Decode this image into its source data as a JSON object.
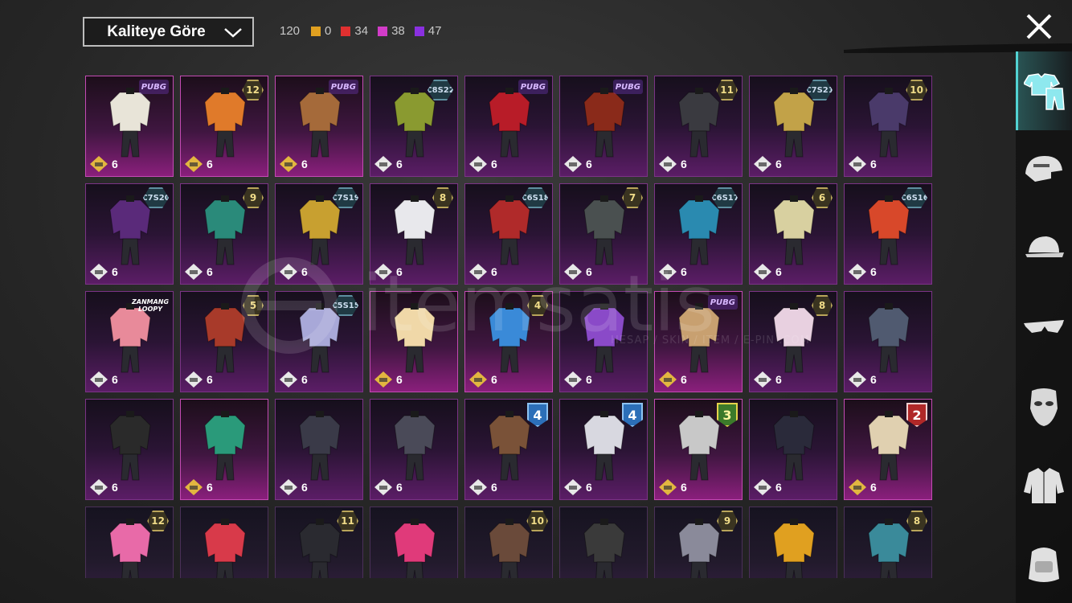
{
  "header": {
    "sort_label": "Kaliteye Göre",
    "total_count": "120",
    "quality_counts": [
      {
        "value": "0",
        "color": "#e0a020"
      },
      {
        "value": "34",
        "color": "#e03030"
      },
      {
        "value": "38",
        "color": "#d23cc8"
      },
      {
        "value": "47",
        "color": "#8a30e0"
      }
    ]
  },
  "sidebar": {
    "tabs": [
      {
        "name": "outfit-tab",
        "icon": "shirt-pants-icon",
        "active": true
      },
      {
        "name": "helmet-tab",
        "icon": "helmet-icon"
      },
      {
        "name": "cap-tab",
        "icon": "cap-icon"
      },
      {
        "name": "glasses-tab",
        "icon": "glasses-icon"
      },
      {
        "name": "mask-tab",
        "icon": "mask-icon"
      },
      {
        "name": "jacket-tab",
        "icon": "jacket-icon"
      },
      {
        "name": "bag-tab",
        "icon": "backpack-icon"
      }
    ]
  },
  "watermark": {
    "text": "itemsatis",
    "subtext": "HESAP / SKIN / ITEM / E-PIN .COM"
  },
  "items": [
    {
      "quality": "pink",
      "badge": "PUBG",
      "badge_type": "logo",
      "status": "gold",
      "count": "6"
    },
    {
      "quality": "pink",
      "badge": "12",
      "badge_type": "level",
      "status": "gold",
      "count": "6"
    },
    {
      "quality": "pink",
      "badge": "PUBG",
      "badge_type": "logo",
      "status": "gold",
      "count": "6"
    },
    {
      "quality": "purple",
      "badge": "C8S22",
      "badge_type": "season",
      "status": "white",
      "count": "6"
    },
    {
      "quality": "purple",
      "badge": "PUBG",
      "badge_type": "logo",
      "status": "white",
      "count": "6"
    },
    {
      "quality": "purple",
      "badge": "PUBG",
      "badge_type": "logo",
      "status": "white",
      "count": "6"
    },
    {
      "quality": "purple",
      "badge": "11",
      "badge_type": "level",
      "status": "white",
      "count": "6"
    },
    {
      "quality": "purple",
      "badge": "C7S21",
      "badge_type": "season",
      "status": "white",
      "count": "6"
    },
    {
      "quality": "purple",
      "badge": "10",
      "badge_type": "level",
      "status": "white",
      "count": "6"
    },
    {
      "quality": "purple",
      "badge": "C7S20",
      "badge_type": "season",
      "status": "white",
      "count": "6"
    },
    {
      "quality": "purple",
      "badge": "9",
      "badge_type": "level",
      "status": "white",
      "count": "6"
    },
    {
      "quality": "purple",
      "badge": "C7S19",
      "badge_type": "season",
      "status": "white",
      "count": "6"
    },
    {
      "quality": "purple",
      "badge": "8",
      "badge_type": "level",
      "status": "white",
      "count": "6"
    },
    {
      "quality": "purple",
      "badge": "C6S18",
      "badge_type": "season",
      "status": "white",
      "count": "6"
    },
    {
      "quality": "purple",
      "badge": "7",
      "badge_type": "level",
      "status": "white",
      "count": "6"
    },
    {
      "quality": "purple",
      "badge": "C6S17",
      "badge_type": "season",
      "status": "white",
      "count": "6"
    },
    {
      "quality": "purple",
      "badge": "6",
      "badge_type": "level",
      "status": "white",
      "count": "6"
    },
    {
      "quality": "purple",
      "badge": "C6S16",
      "badge_type": "season",
      "status": "white",
      "count": "6"
    },
    {
      "quality": "purple",
      "badge": "ZANMANG LOOPY",
      "badge_type": "text-logo",
      "status": "white",
      "count": "6"
    },
    {
      "quality": "purple",
      "badge": "5",
      "badge_type": "level",
      "status": "white",
      "count": "6"
    },
    {
      "quality": "purple",
      "badge": "C5S15",
      "badge_type": "season",
      "status": "white",
      "count": "6"
    },
    {
      "quality": "pink",
      "badge": "",
      "badge_type": "none",
      "status": "gold",
      "count": "6"
    },
    {
      "quality": "pink",
      "badge": "4",
      "badge_type": "level",
      "status": "gold",
      "count": "6"
    },
    {
      "quality": "purple",
      "badge": "",
      "badge_type": "none",
      "status": "white",
      "count": "6"
    },
    {
      "quality": "pink",
      "badge": "PUBG",
      "badge_type": "logo",
      "status": "gold",
      "count": "6"
    },
    {
      "quality": "purple",
      "badge": "8",
      "badge_type": "level",
      "status": "white",
      "count": "6"
    },
    {
      "quality": "purple",
      "badge": "",
      "badge_type": "none",
      "status": "white",
      "count": "6"
    },
    {
      "quality": "purple",
      "badge": "",
      "badge_type": "none",
      "status": "white",
      "count": "6"
    },
    {
      "quality": "pink",
      "badge": "",
      "badge_type": "none",
      "status": "gold",
      "count": "6"
    },
    {
      "quality": "purple",
      "badge": "",
      "badge_type": "none",
      "status": "white",
      "count": "6"
    },
    {
      "quality": "purple",
      "badge": "",
      "badge_type": "none",
      "status": "white",
      "count": "6"
    },
    {
      "quality": "purple",
      "badge": "4",
      "badge_type": "shield-blue",
      "status": "white",
      "count": "6"
    },
    {
      "quality": "purple",
      "badge": "4",
      "badge_type": "shield-blue",
      "status": "white",
      "count": "6"
    },
    {
      "quality": "pink",
      "badge": "3",
      "badge_type": "shield-green",
      "status": "gold",
      "count": "6"
    },
    {
      "quality": "purple",
      "badge": "",
      "badge_type": "none",
      "status": "white",
      "count": "6"
    },
    {
      "quality": "pink",
      "badge": "2",
      "badge_type": "shield-red",
      "status": "gold",
      "count": "6"
    },
    {
      "quality": "dark",
      "badge": "12",
      "badge_type": "level",
      "status": "none",
      "count": ""
    },
    {
      "quality": "dark",
      "badge": "",
      "badge_type": "none",
      "status": "none",
      "count": ""
    },
    {
      "quality": "dark",
      "badge": "11",
      "badge_type": "level",
      "status": "none",
      "count": ""
    },
    {
      "quality": "dark",
      "badge": "",
      "badge_type": "none",
      "status": "none",
      "count": ""
    },
    {
      "quality": "dark",
      "badge": "10",
      "badge_type": "level",
      "status": "none",
      "count": ""
    },
    {
      "quality": "dark",
      "badge": "",
      "badge_type": "none",
      "status": "none",
      "count": ""
    },
    {
      "quality": "dark",
      "badge": "9",
      "badge_type": "level",
      "status": "none",
      "count": ""
    },
    {
      "quality": "dark",
      "badge": "",
      "badge_type": "none",
      "status": "none",
      "count": ""
    },
    {
      "quality": "dark",
      "badge": "8",
      "badge_type": "level",
      "status": "none",
      "count": ""
    }
  ],
  "outfit_colors": [
    "#e8e4d8",
    "#e07a2a",
    "#a56a3a",
    "#8a9a30",
    "#b81c28",
    "#8a2a1a",
    "#3a3a40",
    "#c2a248",
    "#4a3a6a",
    "#5a2a7a",
    "#2a8a7a",
    "#c8a030",
    "#e8e8ec",
    "#b02a2a",
    "#4a5050",
    "#2a8ab0",
    "#d8d0a0",
    "#d8482a",
    "#e88a9a",
    "#a83a2a",
    "#a8a8d8",
    "#f0d8a8",
    "#3a8ad8",
    "#8a4ac8",
    "#c8a070",
    "#e8d0e0",
    "#505a70",
    "#2a2a2a",
    "#2a9a7a",
    "#3a3a48",
    "#4a4a58",
    "#7a5238",
    "#d8d8e0",
    "#c8c8c8",
    "#2a2a3a",
    "#e0d0b0",
    "#e86aa8",
    "#d83a4a",
    "#2a2a30",
    "#e03a7a",
    "#6a4a3a",
    "#3a3a3a",
    "#8a8a9a",
    "#e0a020",
    "#3a8a9a"
  ]
}
